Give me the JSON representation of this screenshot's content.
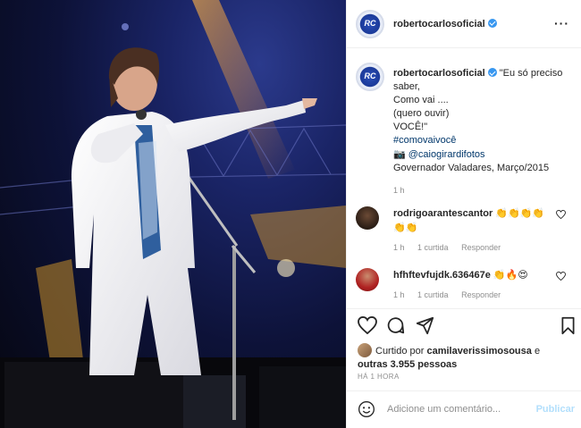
{
  "post": {
    "username": "robertocarlosoficial",
    "avatar_text": "RC",
    "more_icon": "···"
  },
  "caption": {
    "username": "robertocarlosoficial",
    "lines": [
      "\"Eu só preciso",
      "saber,",
      "Como vai ....",
      "(quero ouvir)",
      "VOCÊ!\""
    ],
    "hashtag": "#comovaivocê",
    "camera_emoji": "📷",
    "mention": "@caiogirardifotos",
    "location_date": "Governador Valadares, Março/2015",
    "time": "1 h"
  },
  "comments": [
    {
      "username": "rodrigoarantescantor",
      "text": "👏👏👏👏👏👏",
      "time": "1 h",
      "likes": "1 curtida",
      "reply": "Responder"
    },
    {
      "username": "hfhftevfujdk.636467e",
      "text": "👏🔥😍",
      "time": "1 h",
      "likes": "1 curtida",
      "reply": "Responder"
    }
  ],
  "likes": {
    "prefix": "Curtido por",
    "user": "camilaverissimosousa",
    "conj": "e",
    "others": "outras 3.955 pessoas"
  },
  "posted_ago": "HÁ 1 HORA",
  "add_comment": {
    "placeholder": "Adicione um comentário...",
    "post_label": "Publicar"
  },
  "colors": {
    "verified": "#3897f0",
    "link": "#00376b",
    "muted": "#8e8e8e",
    "post_disabled": "#b2dffc"
  }
}
